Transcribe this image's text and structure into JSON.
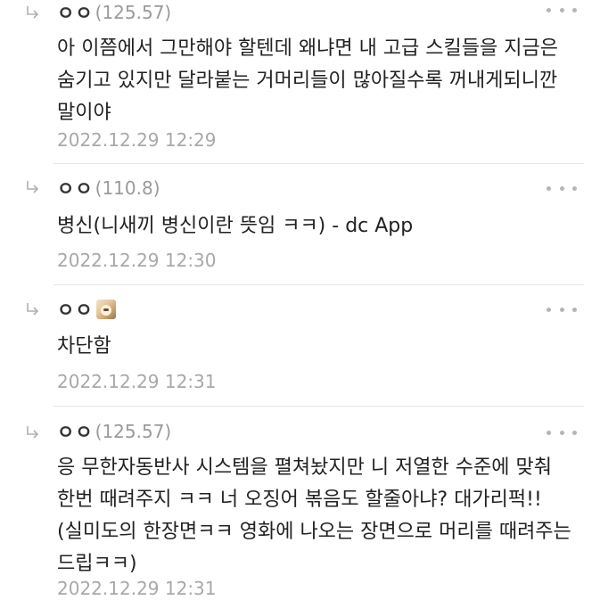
{
  "comments": [
    {
      "nickname": "ㅇㅇ",
      "ip": "(125.57)",
      "text": "아 이쯤에서 그만해야 할텐데 왜냐면 내 고급 스킬들을 지금은 숨기고 있지만 달라붙는 거머리들이 많아질수록 꺼내게되니깐 말이야",
      "date": "2022.12.29 12:29"
    },
    {
      "nickname": "ㅇㅇ",
      "ip": "(110.8)",
      "text": "병신(니새끼 병신이란 뜻임 ㅋㅋ) - dc App",
      "date": "2022.12.29 12:30"
    },
    {
      "nickname": "ㅇㅇ",
      "ip": "",
      "avatar_icon": "dog-avatar-icon",
      "text": "차단함",
      "date": "2022.12.29 12:31"
    },
    {
      "nickname": "ㅇㅇ",
      "ip": "(125.57)",
      "text": "응 무한자동반사 시스템을 펼쳐놨지만 니 저열한 수준에 맞춰 한번 때려주지 ㅋㅋ 너 오징어 볶음도 할줄아냐? 대가리퍽!! (실미도의 한장면ㅋㅋ 영화에 나오는 장면으로 머리를 때려주는 드립ㅋㅋ)",
      "date": "2022.12.29 12:31"
    }
  ]
}
